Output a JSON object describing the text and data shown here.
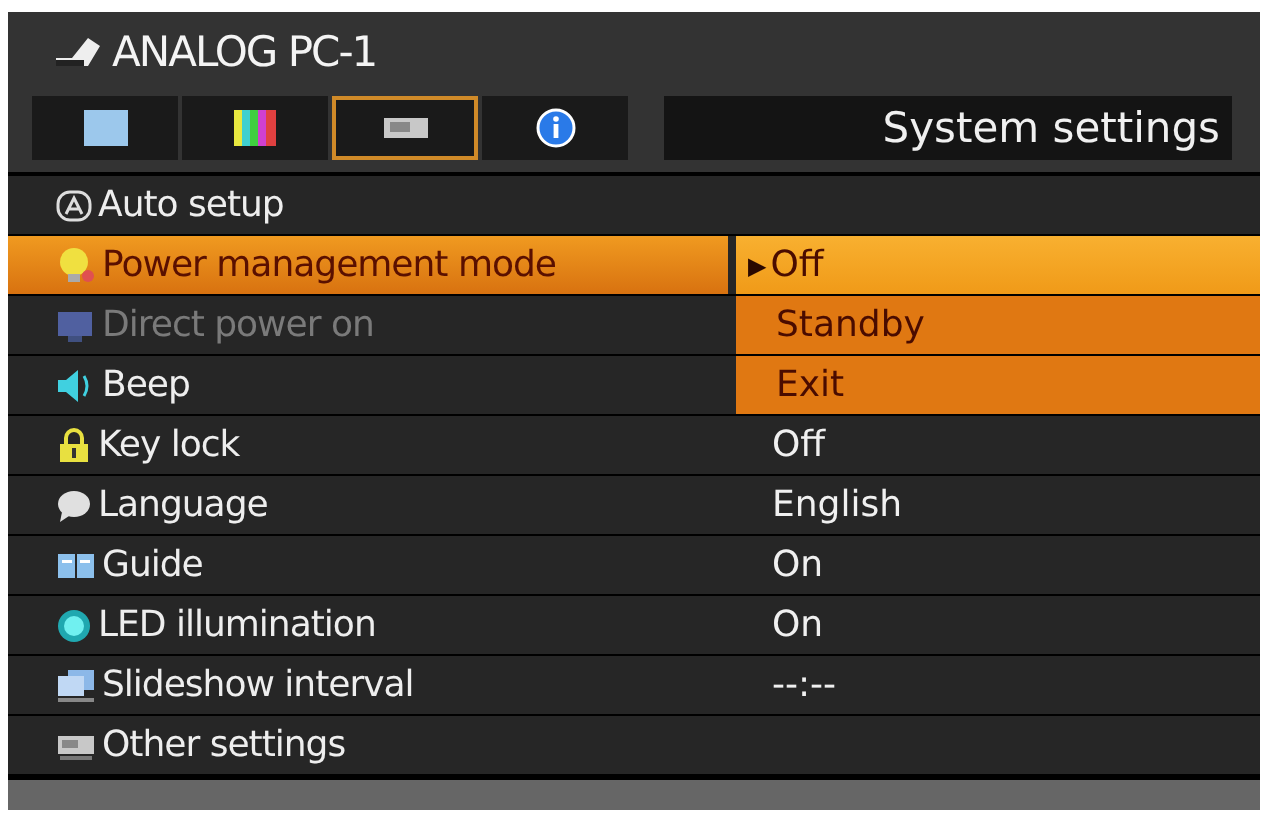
{
  "header": {
    "source": "ANALOG PC-1",
    "section_title": "System settings"
  },
  "tabs": [
    {
      "selected": false
    },
    {
      "selected": false
    },
    {
      "selected": true
    },
    {
      "selected": false
    }
  ],
  "menu": [
    {
      "label": "Auto setup",
      "selected": false,
      "disabled": false
    },
    {
      "label": "Power management mode",
      "selected": true,
      "disabled": false
    },
    {
      "label": "Direct power on",
      "selected": false,
      "disabled": true
    },
    {
      "label": "Beep",
      "selected": false,
      "disabled": false
    },
    {
      "label": "Key lock",
      "value": "Off",
      "selected": false,
      "disabled": false
    },
    {
      "label": "Language",
      "value": "English",
      "selected": false,
      "disabled": false
    },
    {
      "label": "Guide",
      "value": "On",
      "selected": false,
      "disabled": false
    },
    {
      "label": "LED illumination",
      "value": "On",
      "selected": false,
      "disabled": false
    },
    {
      "label": "Slideshow interval",
      "value": "--:--",
      "selected": false,
      "disabled": false
    },
    {
      "label": "Other settings",
      "selected": false,
      "disabled": false
    }
  ],
  "dropdown": {
    "marker": "▶",
    "options": [
      {
        "label": "Off",
        "selected": true
      },
      {
        "label": "Standby",
        "selected": false
      },
      {
        "label": "Exit",
        "selected": false
      }
    ]
  }
}
